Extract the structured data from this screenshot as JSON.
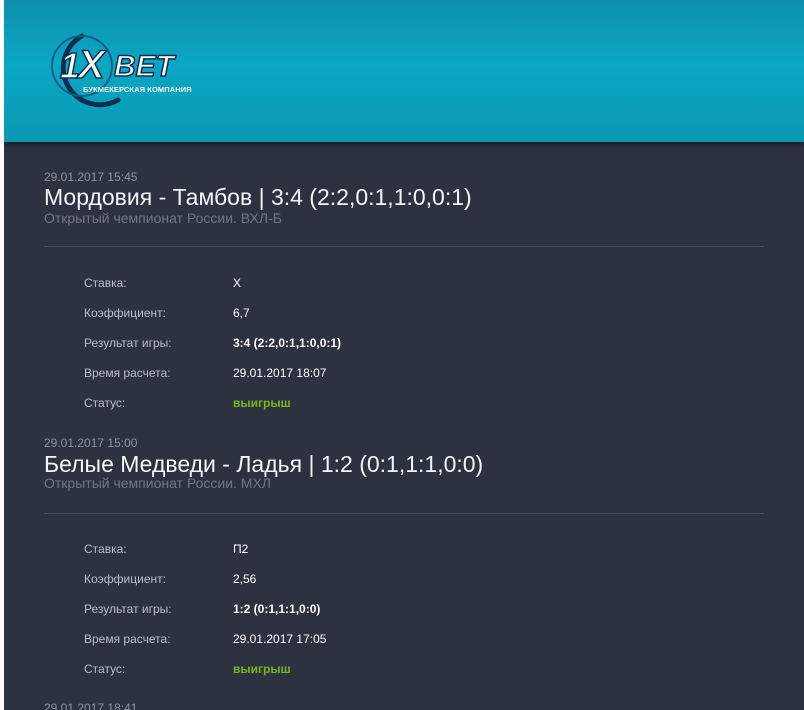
{
  "brand": {
    "name": "1XBET",
    "subtitle": "БУКМЕКЕРСКАЯ КОМПАНИЯ"
  },
  "labels": {
    "stake": "Ставка:",
    "coef": "Коэффициент:",
    "result": "Результат игры:",
    "calc_time": "Время расчета:",
    "status": "Статус:"
  },
  "bets": [
    {
      "date": "29.01.2017 15:45",
      "title": "Мордовия - Тамбов  |  3:4 (2:2,0:1,1:0,0:1)",
      "league": "Открытый чемпионат России. ВХЛ-Б",
      "stake": "Х",
      "coef": "6,7",
      "result": "3:4 (2:2,0:1,1:0,0:1)",
      "calc_time": "29.01.2017 18:07",
      "status": "выигрыш"
    },
    {
      "date": "29.01.2017 15:00",
      "title": "Белые Медведи - Ладья  |  1:2 (0:1,1:1,0:0)",
      "league": "Открытый чемпионат России. МХЛ",
      "stake": "П2",
      "coef": "2,56",
      "result": "1:2 (0:1,1:1,0:0)",
      "calc_time": "29.01.2017 17:05",
      "status": "выигрыш"
    },
    {
      "date": "29.01.2017 18:41"
    }
  ],
  "colors": {
    "header": "#0aa8c4",
    "background": "#2d3240",
    "status_win": "#7cb518"
  }
}
